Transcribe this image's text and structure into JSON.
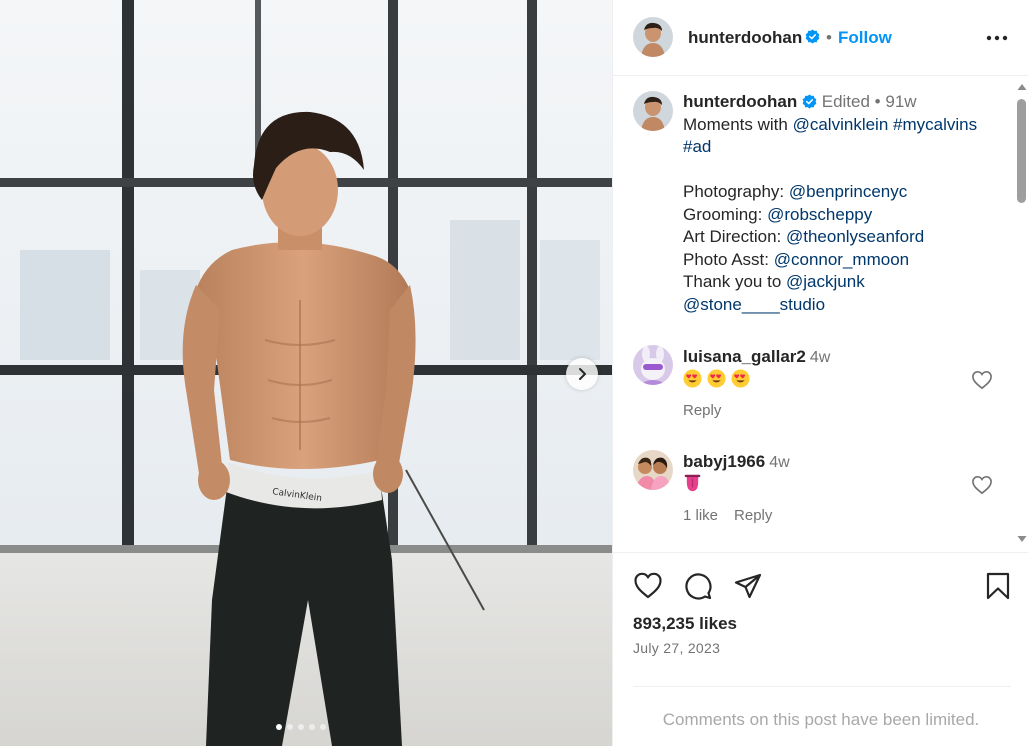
{
  "post": {
    "username": "hunterdoohan",
    "follow_label": "Follow",
    "separator": "•"
  },
  "caption": {
    "username": "hunterdoohan",
    "edited": "Edited",
    "dot": "•",
    "age": "91w",
    "line1_prefix": "Moments with ",
    "line1_mention": "@calvinklein",
    "line1_tag": "#mycalvins",
    "line2_tag": "#ad",
    "credits": [
      {
        "label": "Photography: ",
        "handle": "@benprincenyc"
      },
      {
        "label": "Grooming: ",
        "handle": "@robscheppy"
      },
      {
        "label": "Art Direction: ",
        "handle": "@theonlyseanford"
      },
      {
        "label": "Photo Asst: ",
        "handle": "@connor_mmoon"
      },
      {
        "label": "Thank you to ",
        "handle": "@jackjunk"
      }
    ],
    "last_handle": "@stone____studio"
  },
  "comments": [
    {
      "username": "luisana_gallar2",
      "time": "4w",
      "emoji_icons": [
        "heart-eyes-emoji",
        "heart-eyes-emoji",
        "heart-eyes-emoji"
      ],
      "reply_label": "Reply"
    },
    {
      "username": "babyj1966",
      "time": "4w",
      "emoji_icons": [
        "tongue-emoji"
      ],
      "likes_label": "1 like",
      "reply_label": "Reply"
    }
  ],
  "engagement": {
    "likes": "893,235 likes",
    "date": "July 27, 2023",
    "comments_limited": "Comments on this post have been limited."
  },
  "carousel": {
    "slide_count": 5,
    "active_slide": 1
  },
  "colors": {
    "link": "#00376b",
    "follow": "#0095f6",
    "verified": "#0095f6",
    "muted": "#737373"
  }
}
